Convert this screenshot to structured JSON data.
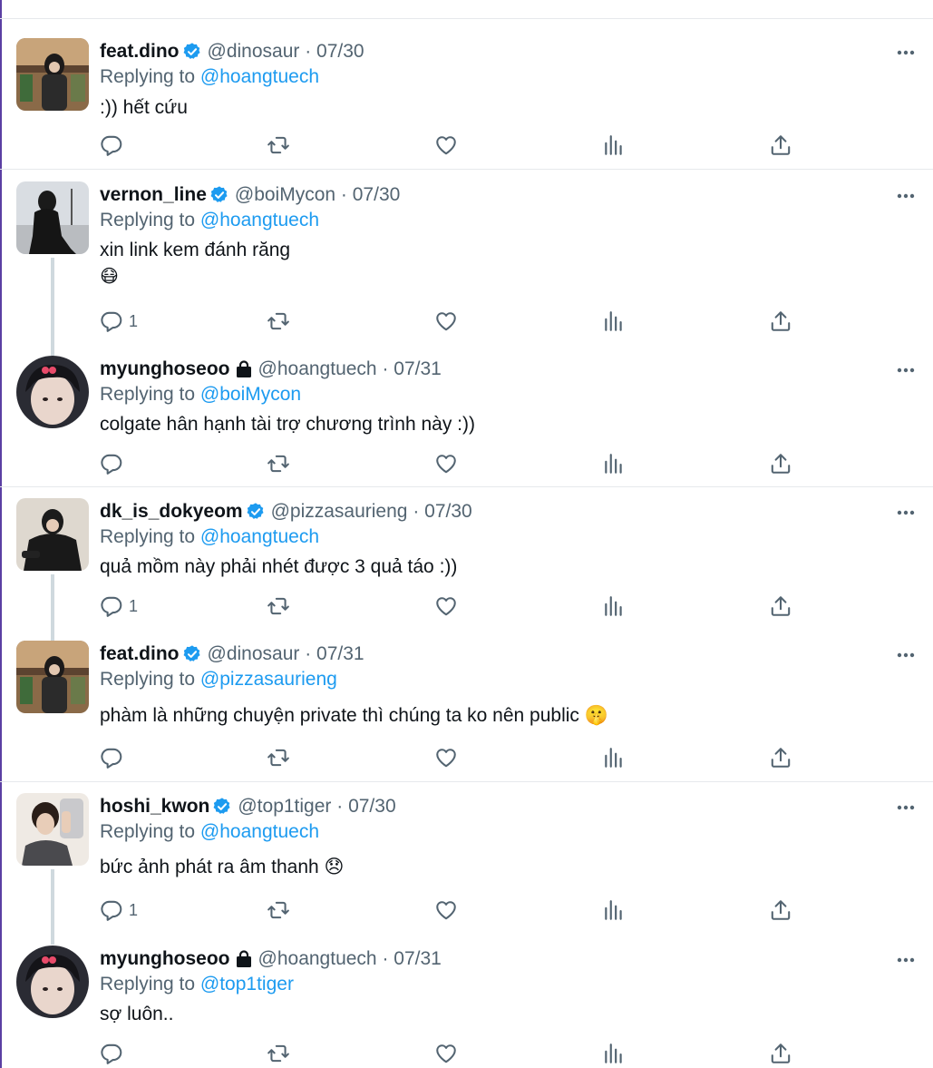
{
  "colors": {
    "accent": "#1d9bf0",
    "muted": "#536471",
    "text": "#0f1419",
    "divider": "#e6e9ec"
  },
  "icons": {
    "verified": "verified-badge-icon",
    "protected": "lock-icon",
    "more": "more-dots-icon",
    "reply": "reply-icon",
    "retweet": "retweet-icon",
    "like": "heart-icon",
    "analytics": "analytics-icon",
    "share": "share-icon"
  },
  "replying_prefix": "Replying to",
  "tweets": [
    {
      "name": "feat.dino",
      "handle": "@dinosaur",
      "date": "07/30",
      "replying_to": "@hoangtuech",
      "text": ":)) hết cứu",
      "reply_count": ""
    },
    {
      "name": "vernon_line",
      "handle": "@boiMycon",
      "date": "07/30",
      "replying_to": "@hoangtuech",
      "text": "xin link kem đánh răng",
      "emoji": "😷",
      "reply_count": "1"
    },
    {
      "name": "myunghoseoo",
      "handle": "@hoangtuech",
      "date": "07/31",
      "replying_to": "@boiMycon",
      "text": "colgate hân hạnh tài trợ chương trình này :))",
      "reply_count": ""
    },
    {
      "name": "dk_is_dokyeom",
      "handle": "@pizzasaurieng",
      "date": "07/30",
      "replying_to": "@hoangtuech",
      "text": "quả mồm này phải nhét được 3 quả táo :))",
      "reply_count": "1"
    },
    {
      "name": "feat.dino",
      "handle": "@dinosaur",
      "date": "07/31",
      "replying_to": "@pizzasaurieng",
      "text": "phàm là những chuyện private thì chúng ta ko nên public 🤫",
      "reply_count": ""
    },
    {
      "name": "hoshi_kwon",
      "handle": "@top1tiger",
      "date": "07/30",
      "replying_to": "@hoangtuech",
      "text": "bức ảnh phát ra âm thanh 😞",
      "reply_count": "1"
    },
    {
      "name": "myunghoseoo",
      "handle": "@hoangtuech",
      "date": "07/31",
      "replying_to": "@top1tiger",
      "text": "sợ luôn..",
      "reply_count": ""
    }
  ]
}
